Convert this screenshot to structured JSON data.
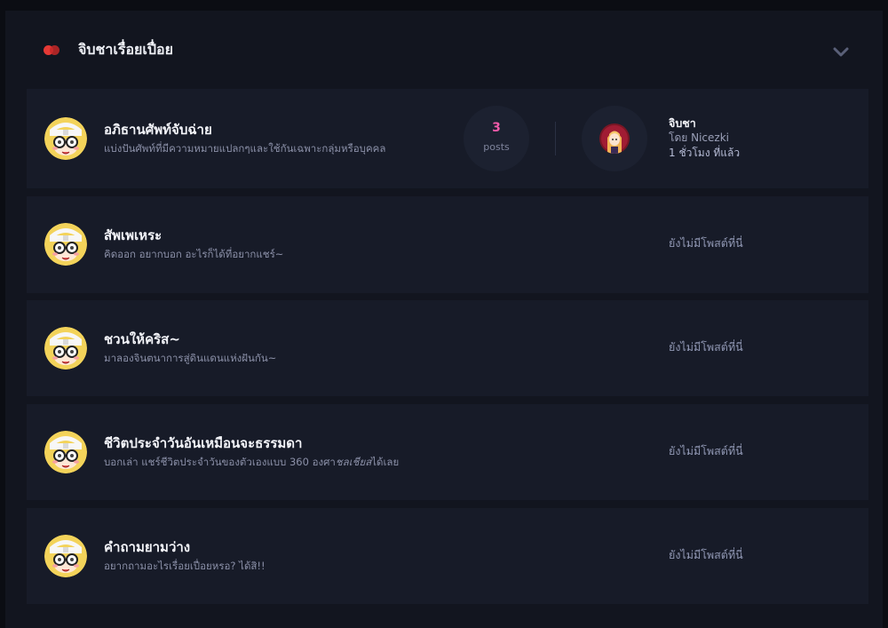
{
  "category": {
    "title": "จิบชาเรื่อยเปื่อย",
    "accent": "#e53935",
    "collapse_icon": "chevron-down-icon"
  },
  "forums": [
    {
      "title": "อภิธานศัพท์จับฉ่าย",
      "description": "แบ่งปันศัพท์ที่มีความหมายแปลกๆและใช้กันเฉพาะกลุ่มหรือบุคคล",
      "posts_count": "3",
      "posts_label": "posts",
      "last_post": {
        "title": "จิบชา",
        "by_prefix": "โดย",
        "author": "Nicezki",
        "time": "1 ชั่วโมง ที่แล้ว"
      }
    },
    {
      "title": "สัพเพเหระ",
      "description": "คิดออก อยากบอก อะไรก็ได้ที่อยากแชร์~",
      "no_posts": "ยังไม่มีโพสต์ที่นี่"
    },
    {
      "title": "ชวนให้คริส~",
      "description": "มาลองจินตนาการสู่ดินแดนแห่งฝันกัน~",
      "no_posts": "ยังไม่มีโพสต์ที่นี่"
    },
    {
      "title": "ชีวิตประจำวันอันเหมือนจะธรรมดา",
      "description_pre": "บอกเล่า แชร์ชีวิตประจำวันของตัวเองแบบ 360 องศา",
      "description_em": "ชลเชียส",
      "description_post": "ได้เลย",
      "no_posts": "ยังไม่มีโพสต์ที่นี่"
    },
    {
      "title": "คำถามยามว่าง",
      "description": "อยากถามอะไรเรื่อยเปื่อยหรอ? ได้สิ!!",
      "no_posts": "ยังไม่มีโพสต์ที่นี่"
    }
  ],
  "colors": {
    "page_bg": "#0b0d13",
    "panel_bg": "#12151f",
    "row_bg": "#171b28",
    "posts_count": "#f05aa8"
  }
}
